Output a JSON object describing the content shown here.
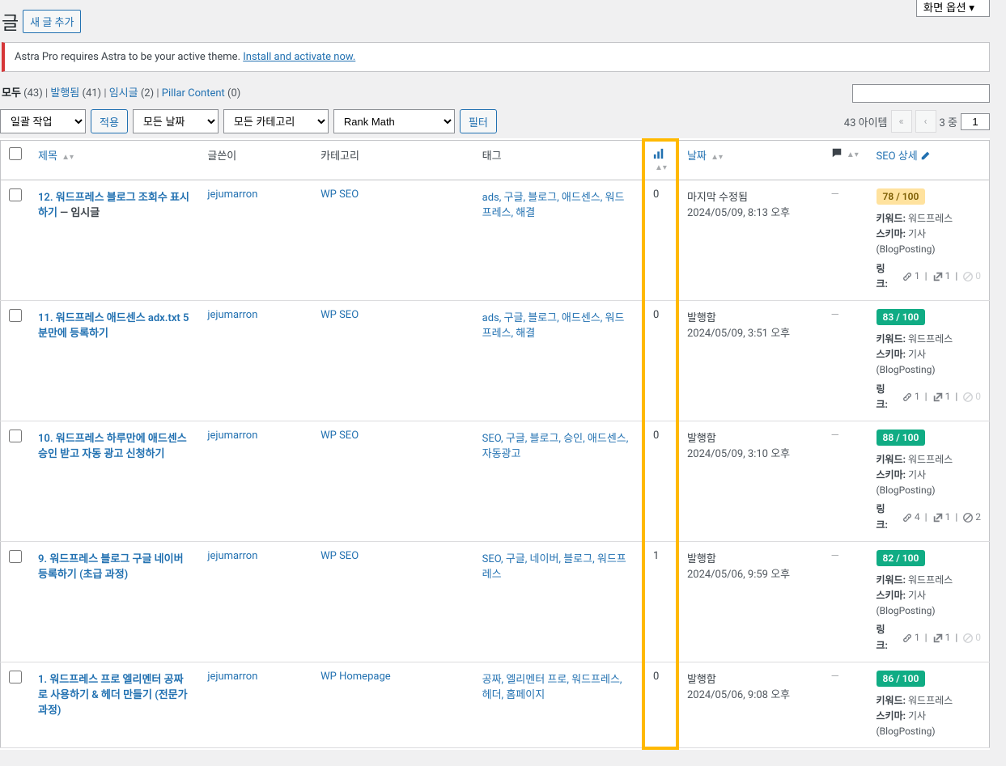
{
  "heading": {
    "title": "글",
    "add_new": "새 글 추가"
  },
  "screen_options": "화면 옵션",
  "notice": {
    "text": "Astra Pro requires Astra to be your active theme. ",
    "link": "Install and activate now."
  },
  "views": {
    "all": {
      "label": "모두",
      "count": "(43)"
    },
    "published": {
      "label": "발행됨",
      "count": "(41)"
    },
    "draft": {
      "label": "임시글",
      "count": "(2)"
    },
    "pillar": {
      "label": "Pillar Content",
      "count": "(0)"
    }
  },
  "filters": {
    "bulk": "일괄 작업",
    "apply": "적용",
    "date": "모든 날짜",
    "cat": "모든 카테고리",
    "rankmath": "Rank Math",
    "filter": "필터"
  },
  "pagination": {
    "items": "43 아이템",
    "of_text": "3 중",
    "current": "1"
  },
  "columns": {
    "title": "제목",
    "author": "글쓴이",
    "cat": "카테고리",
    "tags": "태그",
    "date": "날짜",
    "seo": "SEO 상세"
  },
  "rows": [
    {
      "title": "12. 워드프레스 블로그 조회수 표시하기",
      "state": " — 임시글",
      "author": "jejumarron",
      "cat": "WP SEO",
      "tags": "ads, 구글, 블로그, 애드센스, 워드프레스, 해결",
      "stat": "0",
      "date_state": "마지막 수정됨",
      "date_ts": "2024/05/09, 8:13 오후",
      "comments": "—",
      "score": "78 / 100",
      "score_class": "amber",
      "kw": "워드프레스",
      "schema": "기사 (BlogPosting)",
      "links": {
        "int": "1",
        "ext": "1",
        "none": "0"
      }
    },
    {
      "title": "11. 워드프레스 애드센스 adx.txt 5분만에 등록하기",
      "author": "jejumarron",
      "cat": "WP SEO",
      "tags": "ads, 구글, 블로그, 애드센스, 워드프레스, 해결",
      "stat": "0",
      "date_state": "발행함",
      "date_ts": "2024/05/09, 3:51 오후",
      "comments": "—",
      "score": "83 / 100",
      "score_class": "green",
      "kw": "워드프레스",
      "schema": "기사 (BlogPosting)",
      "links": {
        "int": "1",
        "ext": "1",
        "none": "0"
      }
    },
    {
      "title": "10. 워드프레스 하루만에 애드센스 승인 받고 자동 광고 신청하기",
      "author": "jejumarron",
      "cat": "WP SEO",
      "tags": "SEO, 구글, 블로그, 승인, 애드센스, 자동광고",
      "stat": "0",
      "date_state": "발행함",
      "date_ts": "2024/05/09, 3:10 오후",
      "comments": "—",
      "score": "88 / 100",
      "score_class": "green",
      "kw": "워드프레스",
      "schema": "기사 (BlogPosting)",
      "links": {
        "int": "4",
        "ext": "1",
        "none": "2"
      }
    },
    {
      "title": "9. 워드프레스 블로그 구글 네이버 등록하기 (초급 과정)",
      "author": "jejumarron",
      "cat": "WP SEO",
      "tags": "SEO, 구글, 네이버, 블로그, 워드프레스",
      "stat": "1",
      "date_state": "발행함",
      "date_ts": "2024/05/06, 9:59 오후",
      "comments": "—",
      "score": "82 / 100",
      "score_class": "green",
      "kw": "워드프레스",
      "schema": "기사 (BlogPosting)",
      "links": {
        "int": "1",
        "ext": "1",
        "none": "0"
      }
    },
    {
      "title": "1. 워드프레스 프로 엘리멘터 공짜로 사용하기 & 헤더 만들기 (전문가 과정)",
      "author": "jejumarron",
      "cat": "WP Homepage",
      "tags": "공짜, 엘리멘터 프로, 워드프레스, 헤더, 홈페이지",
      "stat": "0",
      "date_state": "발행함",
      "date_ts": "2024/05/06, 9:08 오후",
      "comments": "—",
      "score": "86 / 100",
      "score_class": "green",
      "kw": "워드프레스",
      "schema": "기사 (BlogPosting)",
      "links": null
    }
  ],
  "seo_labels": {
    "keyword": "키워드:",
    "schema": "스키마:",
    "links": "링크:"
  }
}
